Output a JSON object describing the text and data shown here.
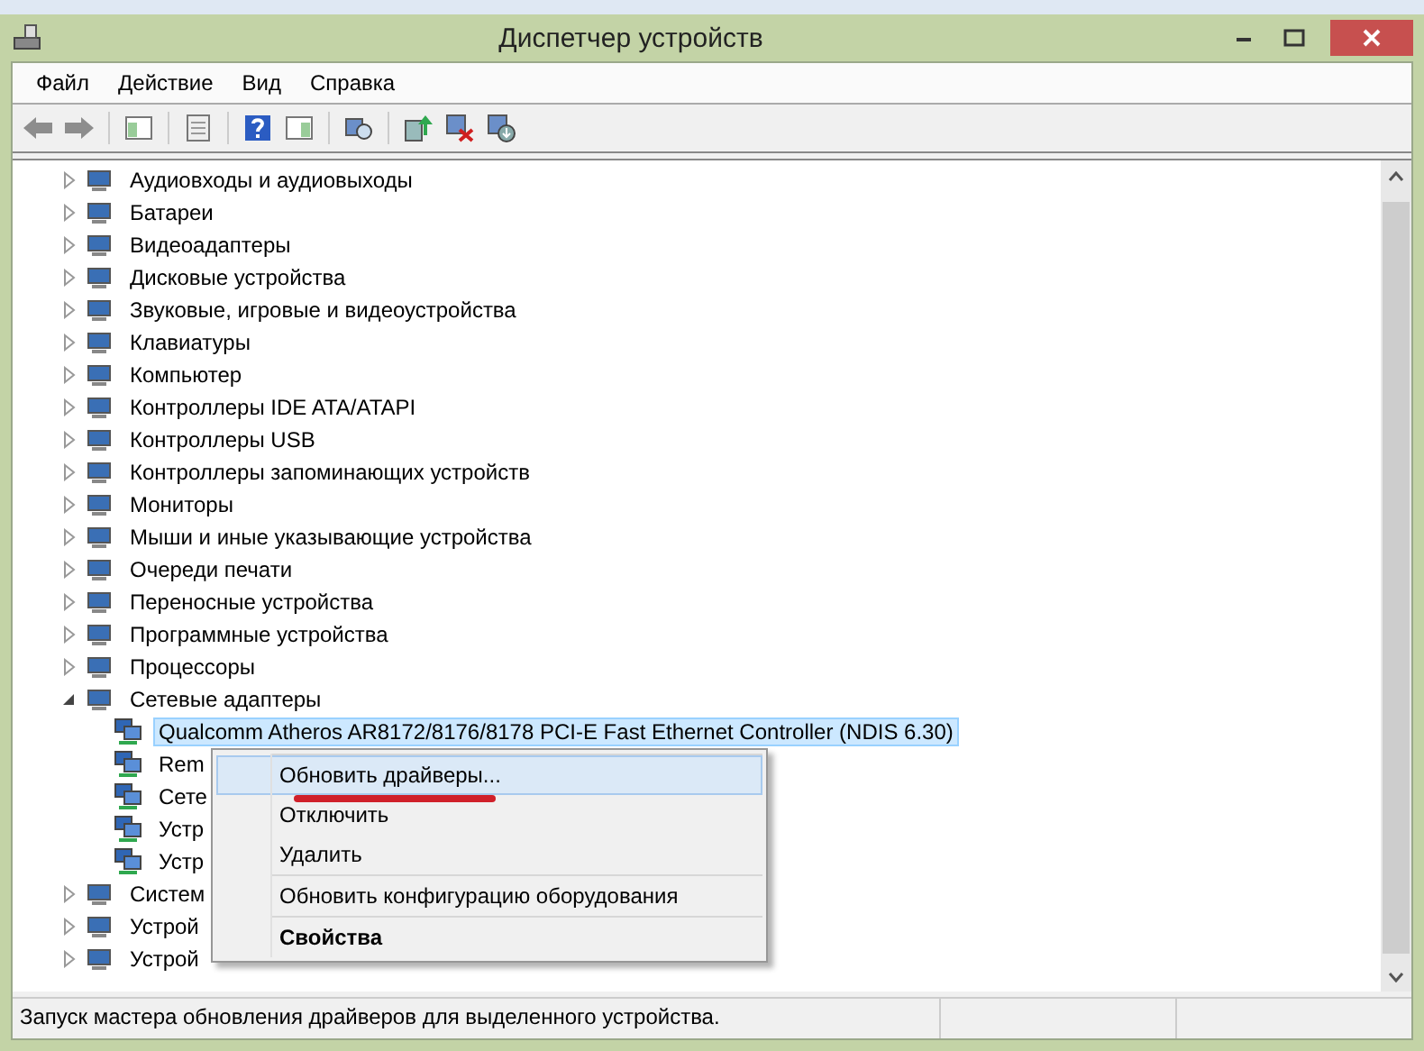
{
  "window": {
    "title": "Диспетчер устройств"
  },
  "menu": [
    {
      "label": "Файл"
    },
    {
      "label": "Действие"
    },
    {
      "label": "Вид"
    },
    {
      "label": "Справка"
    }
  ],
  "tree": [
    {
      "label": "Аудиовходы и аудиовыходы",
      "expanded": false
    },
    {
      "label": "Батареи",
      "expanded": false
    },
    {
      "label": "Видеоадаптеры",
      "expanded": false
    },
    {
      "label": "Дисковые устройства",
      "expanded": false
    },
    {
      "label": "Звуковые, игровые и видеоустройства",
      "expanded": false
    },
    {
      "label": "Клавиатуры",
      "expanded": false
    },
    {
      "label": "Компьютер",
      "expanded": false
    },
    {
      "label": "Контроллеры IDE ATA/ATAPI",
      "expanded": false
    },
    {
      "label": "Контроллеры USB",
      "expanded": false
    },
    {
      "label": "Контроллеры запоминающих устройств",
      "expanded": false
    },
    {
      "label": "Мониторы",
      "expanded": false
    },
    {
      "label": "Мыши и иные указывающие устройства",
      "expanded": false
    },
    {
      "label": "Очереди печати",
      "expanded": false
    },
    {
      "label": "Переносные устройства",
      "expanded": false
    },
    {
      "label": "Программные устройства",
      "expanded": false
    },
    {
      "label": "Процессоры",
      "expanded": false
    },
    {
      "label": "Сетевые адаптеры",
      "expanded": true,
      "children": [
        {
          "label": "Qualcomm Atheros AR8172/8176/8178 PCI-E Fast Ethernet Controller (NDIS 6.30)",
          "selected": true
        },
        {
          "label": "Rem",
          "selected": false
        },
        {
          "label": "Сете",
          "selected": false
        },
        {
          "label": "Устр",
          "selected": false
        },
        {
          "label": "Устр",
          "selected": false
        }
      ]
    },
    {
      "label": "Систем",
      "expanded": false
    },
    {
      "label": "Устрой",
      "expanded": false
    },
    {
      "label": "Устрой",
      "expanded": false
    }
  ],
  "context_menu": {
    "groups": [
      [
        {
          "label": "Обновить драйверы...",
          "selected": true,
          "kind": "item"
        },
        {
          "label": "Отключить",
          "selected": false,
          "kind": "item"
        },
        {
          "label": "Удалить",
          "selected": false,
          "kind": "item"
        }
      ],
      [
        {
          "label": "Обновить конфигурацию оборудования",
          "selected": false,
          "kind": "item"
        }
      ],
      [
        {
          "label": "Свойства",
          "selected": false,
          "kind": "default"
        }
      ]
    ]
  },
  "status_bar": {
    "text": "Запуск мастера обновления драйверов для выделенного устройства."
  }
}
